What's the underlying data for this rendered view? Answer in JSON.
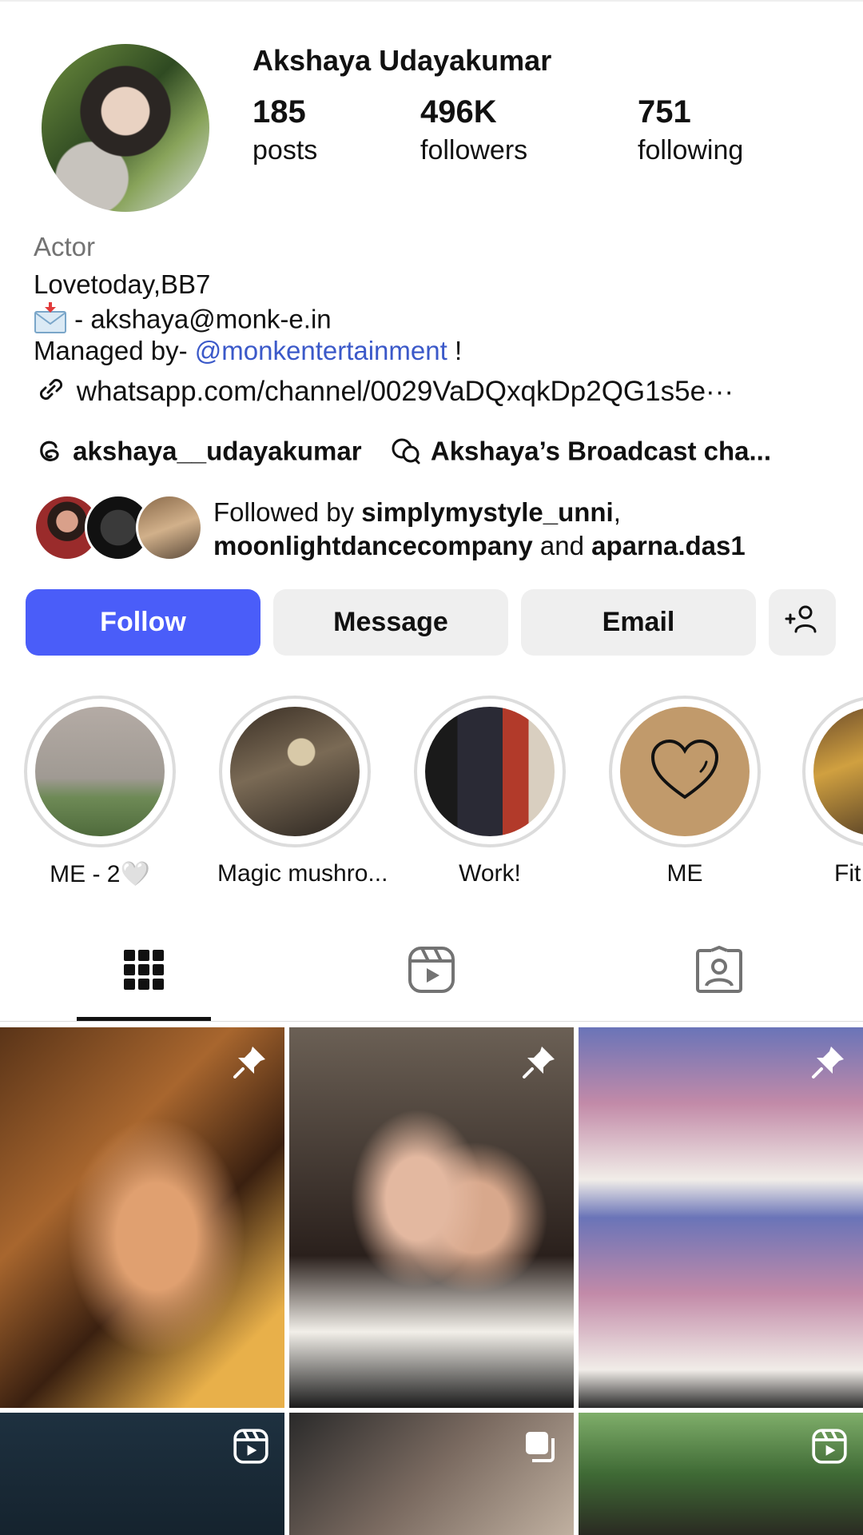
{
  "profile": {
    "name": "Akshaya Udayakumar",
    "posts_count": "185",
    "posts_label": "posts",
    "followers_count": "496K",
    "followers_label": "followers",
    "following_count": "751",
    "following_label": "following"
  },
  "bio": {
    "category": "Actor",
    "line1": "Lovetoday,BB7",
    "email_line": " - akshaya@monk-e.in",
    "managed_prefix": "Managed by- ",
    "managed_mention": "@monkentertainment",
    "managed_suffix": " !",
    "link": "whatsapp.com/channel/0029VaDQxqkDp2QG1s5e···",
    "threads_handle": "akshaya__udayakumar",
    "broadcast": "Akshaya’s Broadcast cha..."
  },
  "followed_by": {
    "prefix": "Followed by ",
    "user1": "simplymystyle_unni",
    "sep1": ",",
    "user2": "moonlightdancecompany",
    "and": " and ",
    "user3": "aparna.das1"
  },
  "buttons": {
    "follow": "Follow",
    "message": "Message",
    "email": "Email",
    "suggest_icon": "add-person-icon"
  },
  "highlights": [
    {
      "label": "ME - 2🤍"
    },
    {
      "label": "Magic mushro..."
    },
    {
      "label": "Work!"
    },
    {
      "label": "ME"
    },
    {
      "label": "Fit"
    }
  ],
  "tabs": {
    "grid_icon": "grid-icon",
    "reels_icon": "reels-icon",
    "tagged_icon": "tagged-icon"
  },
  "colors": {
    "accent": "#4a5df9",
    "mention": "#3b59c9",
    "secondary_text": "#737373",
    "button_grey": "#efefef"
  }
}
